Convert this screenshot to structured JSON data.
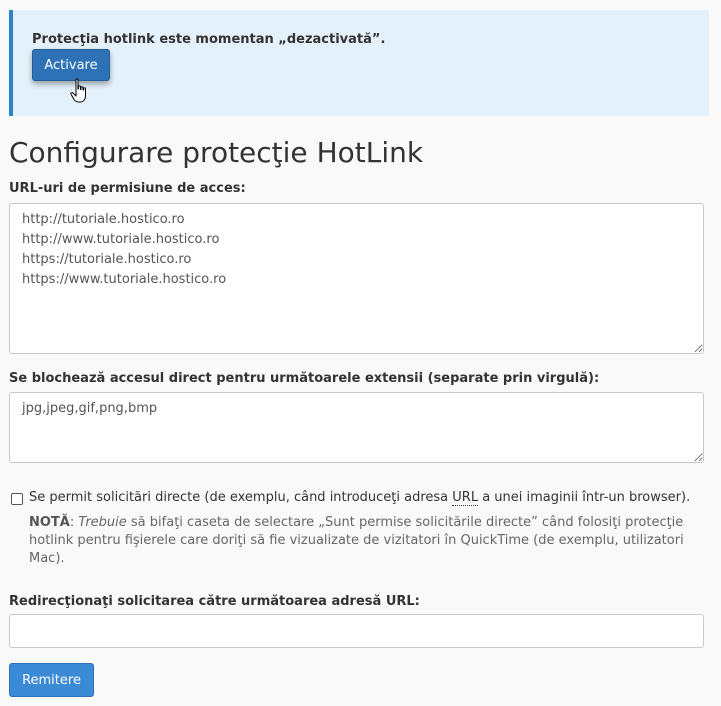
{
  "alert": {
    "message": "Protecţia hotlink este momentan „dezactivată”.",
    "activate_label": "Activare"
  },
  "page_title": "Configurare protecţie HotLink",
  "allowed_urls": {
    "label": "URL-uri de permisiune de acces:",
    "value": "http://tutoriale.hostico.ro\nhttp://www.tutoriale.hostico.ro\nhttps://tutoriale.hostico.ro\nhttps://www.tutoriale.hostico.ro"
  },
  "extensions": {
    "label": "Se blochează accesul direct pentru următoarele extensii (separate prin virgulă):",
    "value": "jpg,jpeg,gif,png,bmp"
  },
  "direct_requests": {
    "checked": false,
    "label_before": "Se permit solicitări directe (de exemplu, când introduceţi adresa ",
    "label_abbr": "URL",
    "label_after": " a unei imaginii într-un browser).",
    "note_prefix": "NOTĂ",
    "note_colon": ": ",
    "note_emph": "Trebuie",
    "note_text": " să bifaţi caseta de selectare „Sunt permise solicitările directe” când folosiţi protecţie hotlink pentru fişierele care doriţi să fie vizualizate de vizitatori în QuickTime (de exemplu, utilizatori Mac)."
  },
  "redirect": {
    "label": "Redirecţionaţi solicitarea către următoarea adresă URL:",
    "value": ""
  },
  "submit_label": "Remitere",
  "colors": {
    "alert_bg": "#e4f1fa",
    "alert_border": "#2c85c7",
    "primary_button": "#2d72b6",
    "submit_button": "#3a8ad6"
  }
}
